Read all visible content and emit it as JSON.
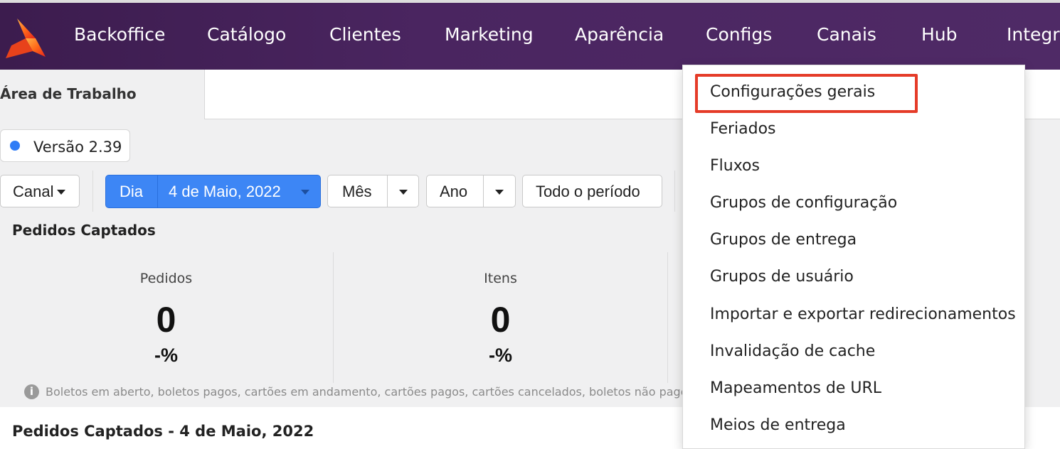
{
  "nav": {
    "logo_icon": "brand-logo-icon",
    "items": [
      "Backoffice",
      "Catálogo",
      "Clientes",
      "Marketing",
      "Aparência",
      "Configs",
      "Canais",
      "Hub",
      "Integra"
    ]
  },
  "tabs": {
    "active": "Área de Trabalho"
  },
  "version": {
    "label": "Versão 2.39",
    "dot_color": "#2f7cf6"
  },
  "filters": {
    "canal": "Canal",
    "day_label": "Dia",
    "day_value": "4 de Maio, 2022",
    "month": "Mês",
    "year": "Ano",
    "all_period": "Todo o período"
  },
  "stats": {
    "title": "Pedidos Captados",
    "cards": [
      {
        "label": "Pedidos",
        "value": "0",
        "delta": "-%"
      },
      {
        "label": "Itens",
        "value": "0",
        "delta": "-%"
      }
    ],
    "note": "Boletos em aberto, boletos pagos, cartões em andamento, cartões pagos, cartões cancelados, boletos não pagos, pedido"
  },
  "bottom": {
    "title": "Pedidos Captados - 4 de Maio, 2022"
  },
  "dropdown": {
    "items": [
      "Configurações gerais",
      "Feriados",
      "Fluxos",
      "Grupos de configuração",
      "Grupos de entrega",
      "Grupos de usuário",
      "Importar e exportar redirecionamentos",
      "Invalidação de cache",
      "Mapeamentos de URL",
      "Meios de entrega"
    ],
    "highlight_color": "#e53b28"
  },
  "colors": {
    "nav_bg": "#4a2560",
    "accent_blue": "#3d86f5"
  }
}
